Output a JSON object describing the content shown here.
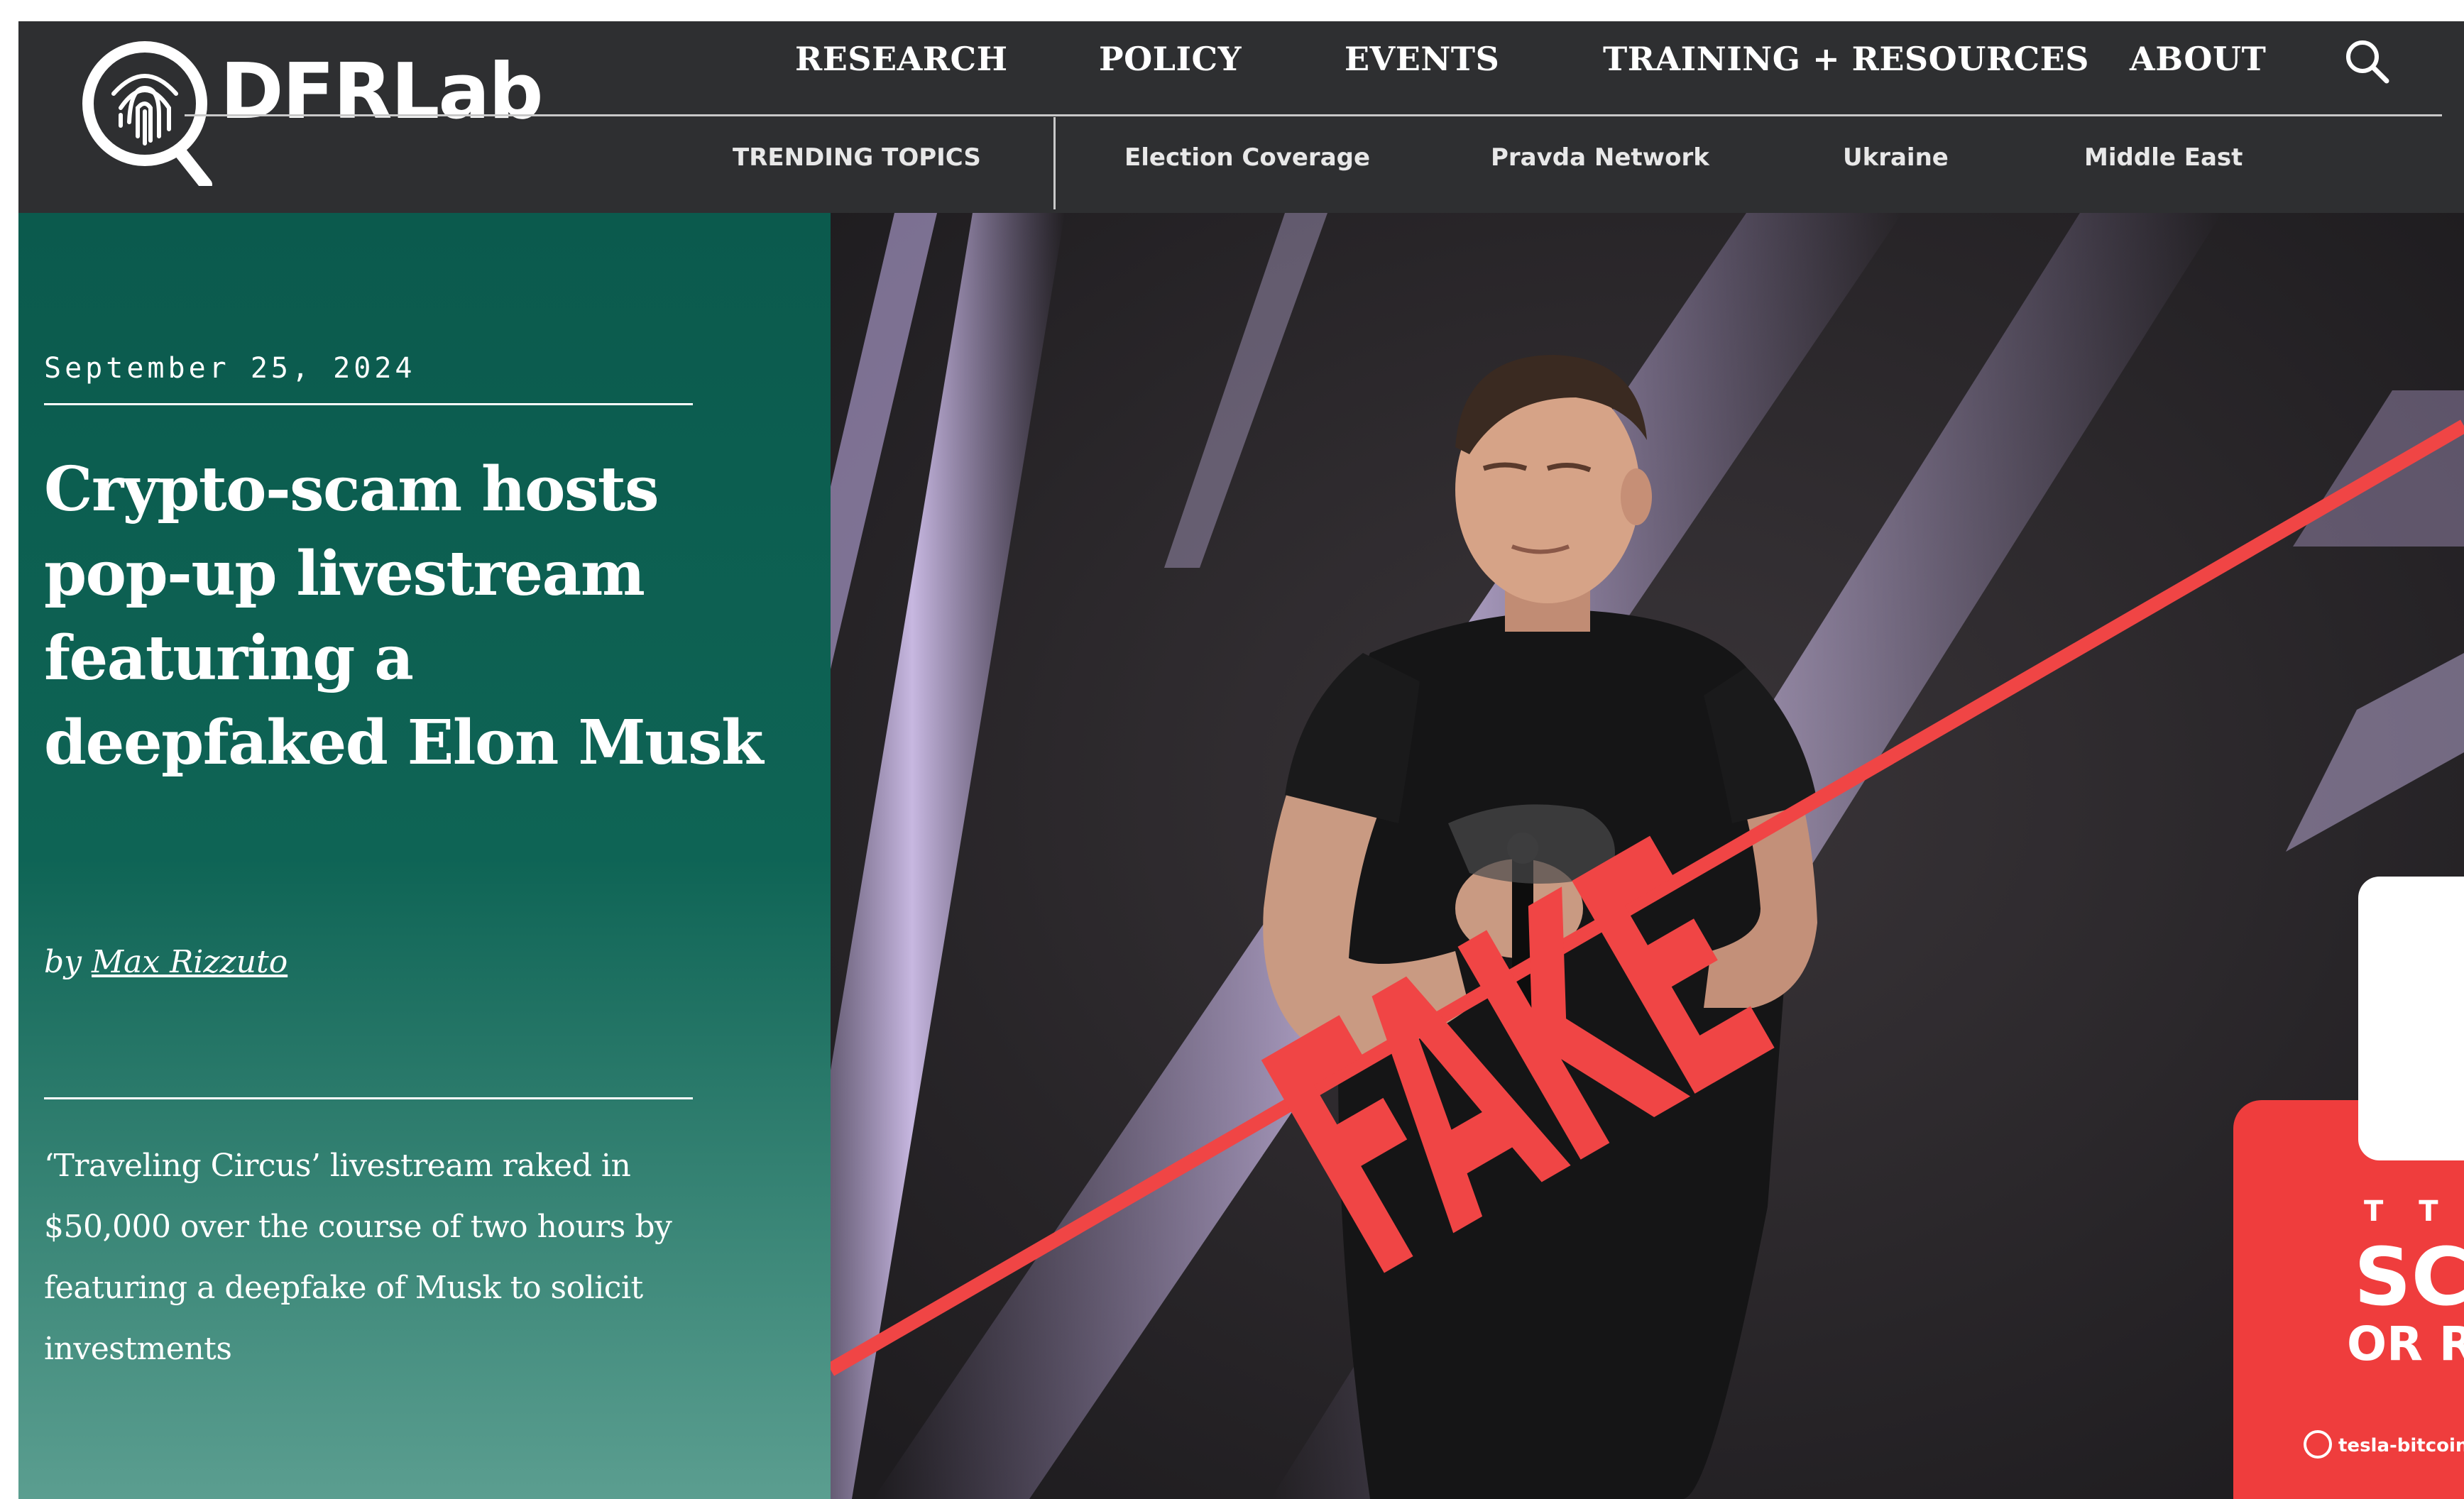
{
  "site": {
    "logo_text": "DFRLab"
  },
  "nav": {
    "main": [
      "RESEARCH",
      "POLICY",
      "EVENTS",
      "TRAINING + RESOURCES",
      "ABOUT"
    ],
    "sub": [
      "TRENDING TOPICS",
      "Election Coverage",
      "Pravda Network",
      "Ukraine",
      "Middle East"
    ],
    "search_icon": "search-icon"
  },
  "article": {
    "date": "September 25, 2024",
    "title": "Crypto-scam hosts pop-up livestream featuring a deepfaked Elon Musk",
    "byline_prefix": "by",
    "author": "Max Rizzuto",
    "summary": "‘Traveling Circus’ livestream raked in $50,000 over the course of two hours by featuring a deepfake of Musk to solicit investments"
  },
  "hero": {
    "stamp_text": "FAKE",
    "overlay_card": {
      "line1": "SC",
      "line2": "OR RI",
      "url": "tesla-bitcoin.c"
    }
  },
  "colors": {
    "header_bg": "#2e2f31",
    "panel_green": "#0e6455",
    "stamp_red": "#f04545",
    "text_white": "#ffffff"
  }
}
